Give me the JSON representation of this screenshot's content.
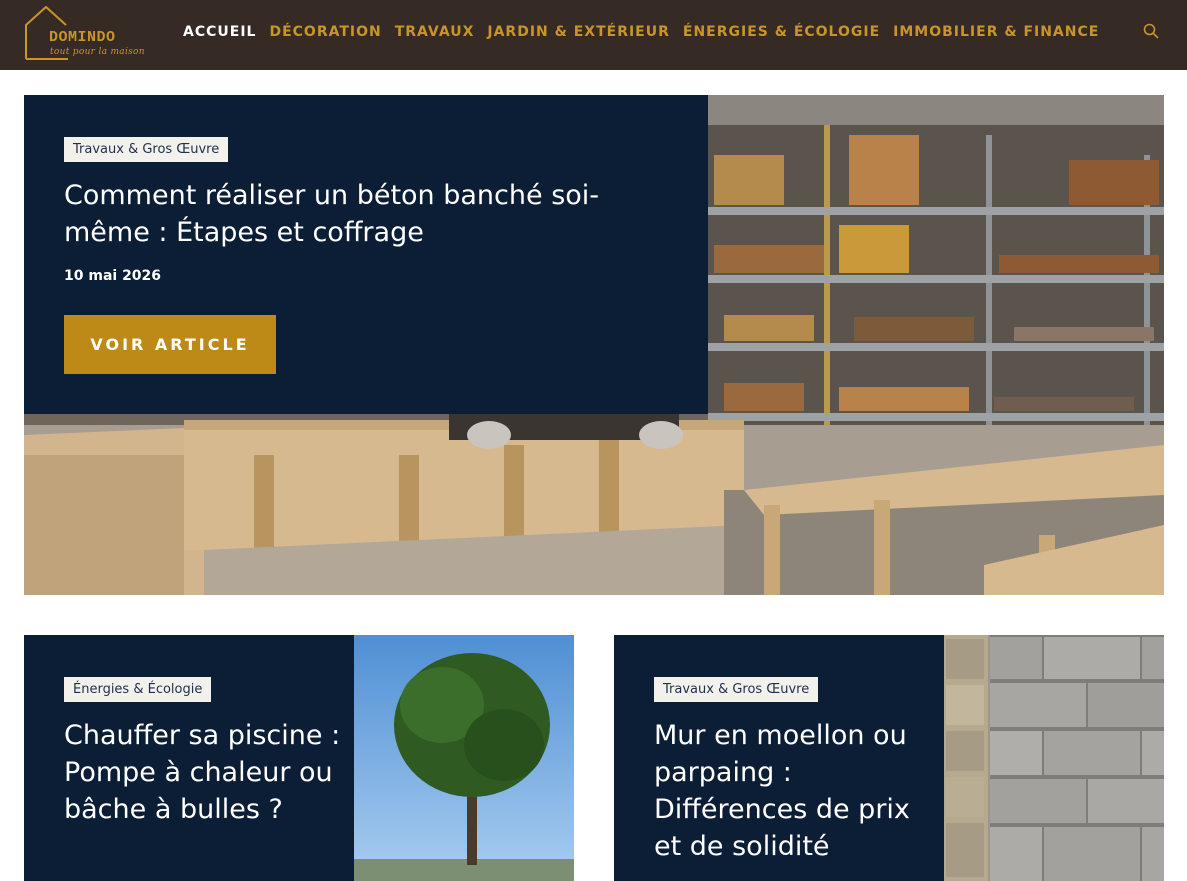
{
  "brand": {
    "name": "DOMINDO",
    "tagline": "tout pour la maison",
    "accent_color": "#c9952a"
  },
  "nav": {
    "items": [
      {
        "label": "ACCUEIL",
        "active": true
      },
      {
        "label": "DÉCORATION",
        "active": false
      },
      {
        "label": "TRAVAUX",
        "active": false
      },
      {
        "label": "JARDIN & EXTÉRIEUR",
        "active": false
      },
      {
        "label": "ÉNERGIES & ÉCOLOGIE",
        "active": false
      },
      {
        "label": "IMMOBILIER & FINANCE",
        "active": false
      }
    ],
    "search_icon": "search-icon"
  },
  "hero": {
    "category": "Travaux & Gros Œuvre",
    "title": "Comment réaliser un béton banché soi-même : Étapes et coffrage",
    "date": "10 mai 2026",
    "cta_label": "VOIR ARTICLE",
    "panel_color": "#0b1e36",
    "cta_color": "#bd8a18"
  },
  "cards": [
    {
      "category": "Énergies & Écologie",
      "title": "Chauffer sa piscine : Pompe à chaleur ou bâche à bulles ?"
    },
    {
      "category": "Travaux & Gros Œuvre",
      "title": "Mur en moellon ou parpaing : Différences de prix et de solidité"
    }
  ]
}
